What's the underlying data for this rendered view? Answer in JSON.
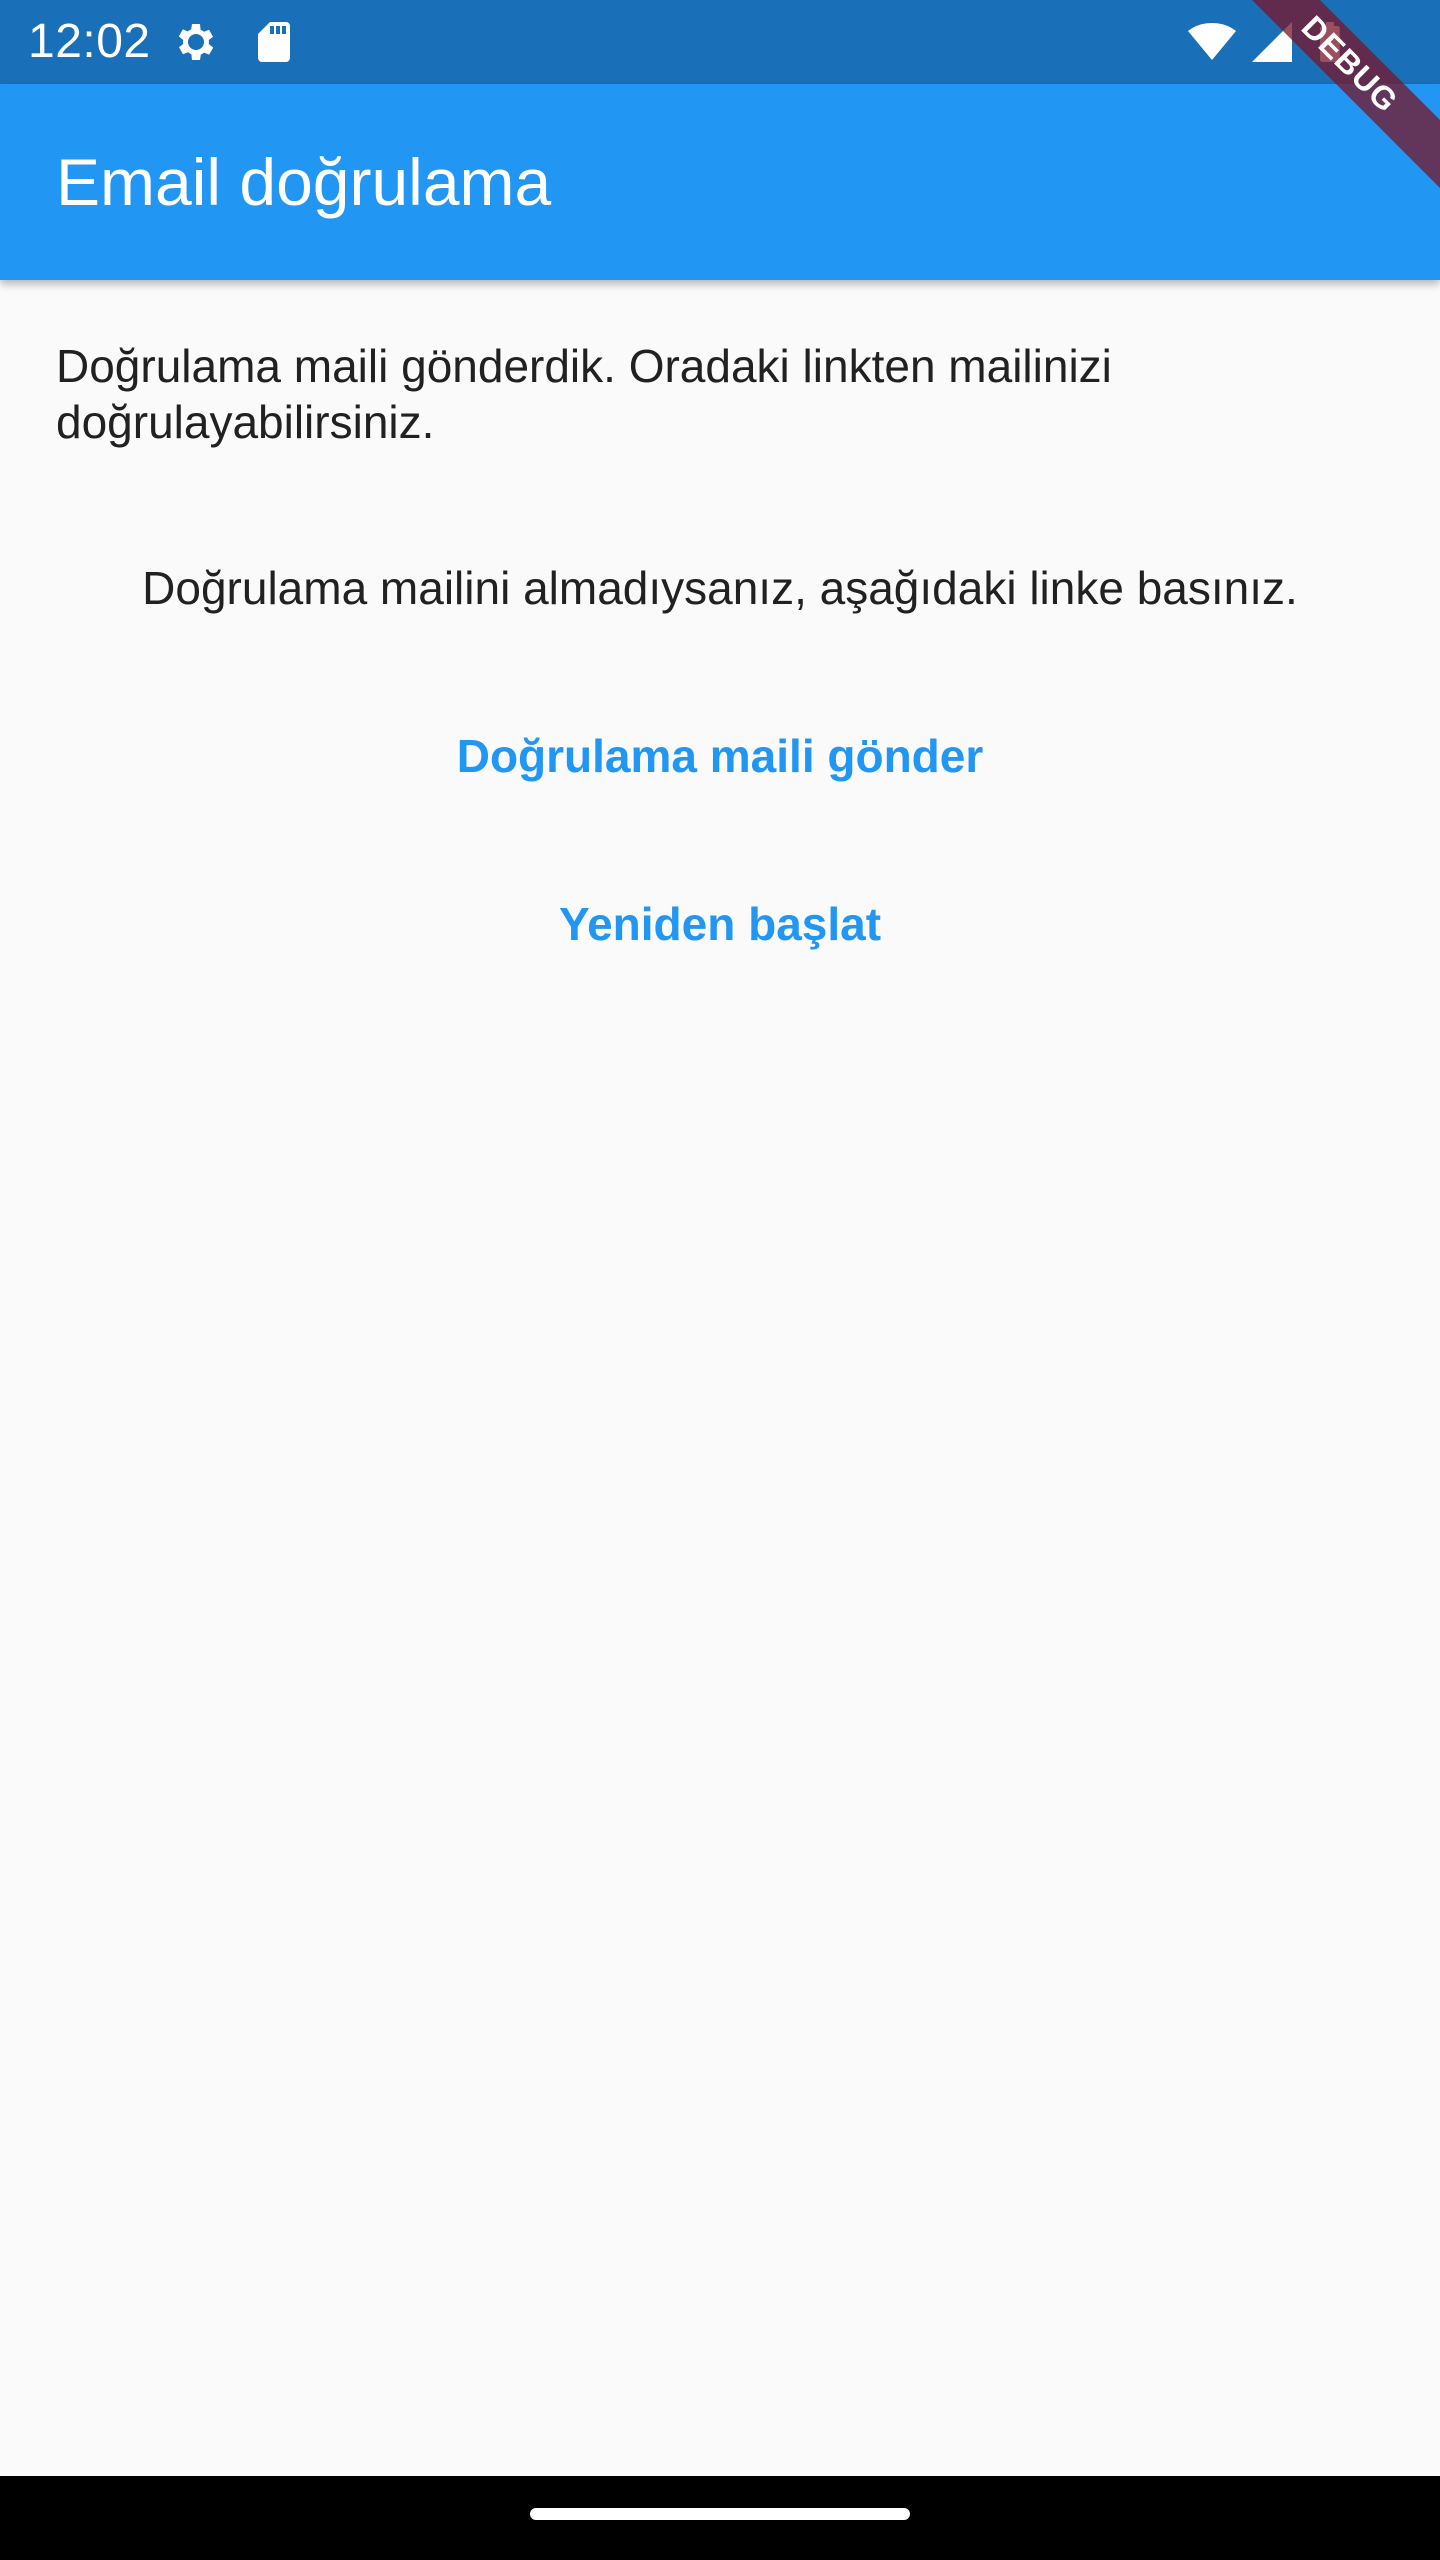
{
  "status_bar": {
    "time": "12:02",
    "icons": [
      "settings-icon",
      "sd-card-icon",
      "wifi-icon",
      "cell-signal-icon",
      "battery-icon"
    ]
  },
  "app_bar": {
    "title": "Email doğrulama",
    "color": "#2196f3"
  },
  "debug_banner": {
    "label": "DEBUG"
  },
  "main": {
    "info_text": "Doğrulama maili gönderdik. Oradaki linkten mailinizi doğrulayabilirsiniz.",
    "hint_text": "Doğrulama mailini almadıysanız, aşağıdaki linke basınız.",
    "send_button_label": "Doğrulama maili gönder",
    "restart_button_label": "Yeniden başlat",
    "accent_color": "#2196f3"
  }
}
